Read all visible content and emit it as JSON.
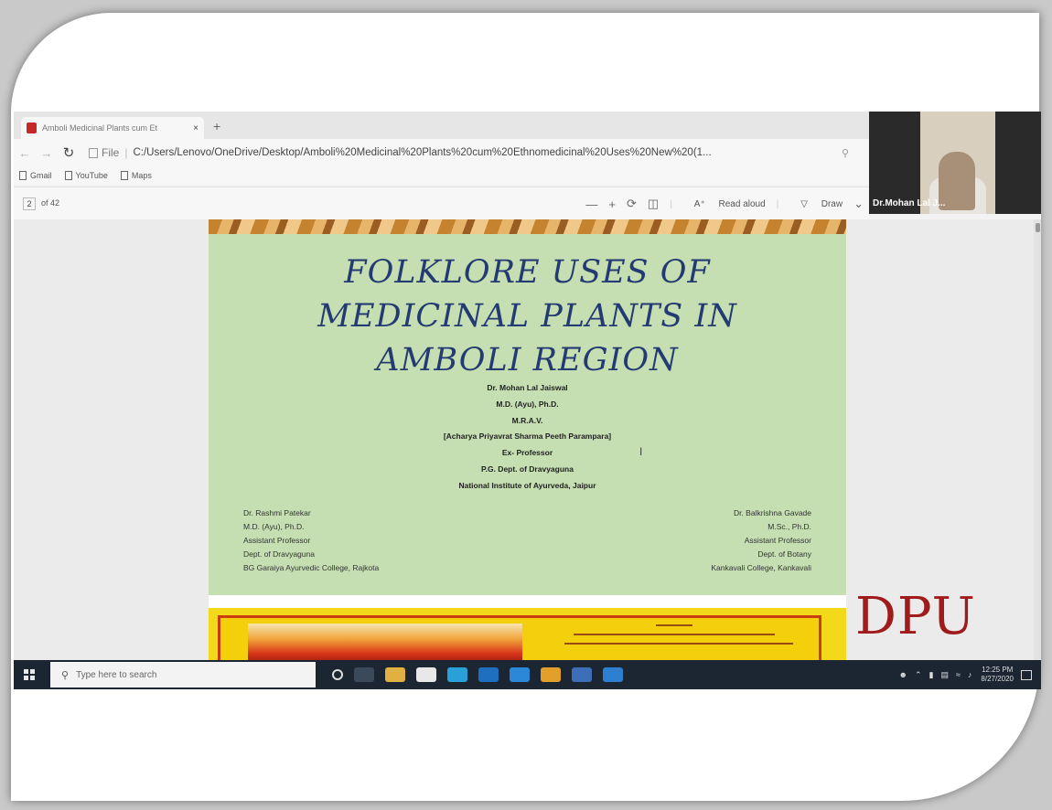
{
  "browser": {
    "tab_title": "Amboli Medicinal Plants cum Et",
    "tab_close": "×",
    "new_tab": "+",
    "address_file_label": "File",
    "address_separator": "|",
    "address_url": "C:/Users/Lenovo/OneDrive/Desktop/Amboli%20Medicinal%20Plants%20cum%20Ethnomedicinal%20Uses%20New%20(1...",
    "favorites": [
      "Gmail",
      "YouTube",
      "Maps"
    ]
  },
  "pdf_toolbar": {
    "page_number": "2",
    "page_total": "of 42",
    "zoom_out": "—",
    "zoom_in": "+",
    "read_aloud": "Read aloud",
    "draw": "Draw"
  },
  "video": {
    "participant_name": "Dr.Mohan Lal J..."
  },
  "slide": {
    "title_lines": [
      "FOLKLORE USES OF",
      "MEDICINAL PLANTS IN",
      "AMBOLI REGION"
    ],
    "author_lines": [
      "Dr. Mohan Lal Jaiswal",
      "M.D. (Ayu), Ph.D.",
      "M.R.A.V.",
      "[Acharya Priyavrat Sharma Peeth Parampara]",
      "Ex- Professor",
      "P.G. Dept. of Dravyaguna",
      "National Institute of Ayurveda, Jaipur"
    ],
    "coauthor_left": [
      "Dr. Rashmi Patekar",
      "M.D. (Ayu), Ph.D.",
      "Assistant Professor",
      "Dept. of Dravyaguna",
      "BG Garaiya Ayurvedic College, Rajkota"
    ],
    "coauthor_right": [
      "Dr. Balkrishna Gavade",
      "M.Sc., Ph.D.",
      "Assistant Professor",
      "Dept. of Botany",
      "Kankavali College, Kankavali"
    ]
  },
  "logo": {
    "text": "DPU"
  },
  "taskbar": {
    "search_placeholder": "Type here to search",
    "clock_time": "12:25 PM",
    "clock_date": "8/27/2020"
  },
  "colors": {
    "slide_background": "#c5dfb2",
    "title_color": "#243a73",
    "logo_color": "#a01c1c",
    "taskbar": "#1b2632"
  }
}
